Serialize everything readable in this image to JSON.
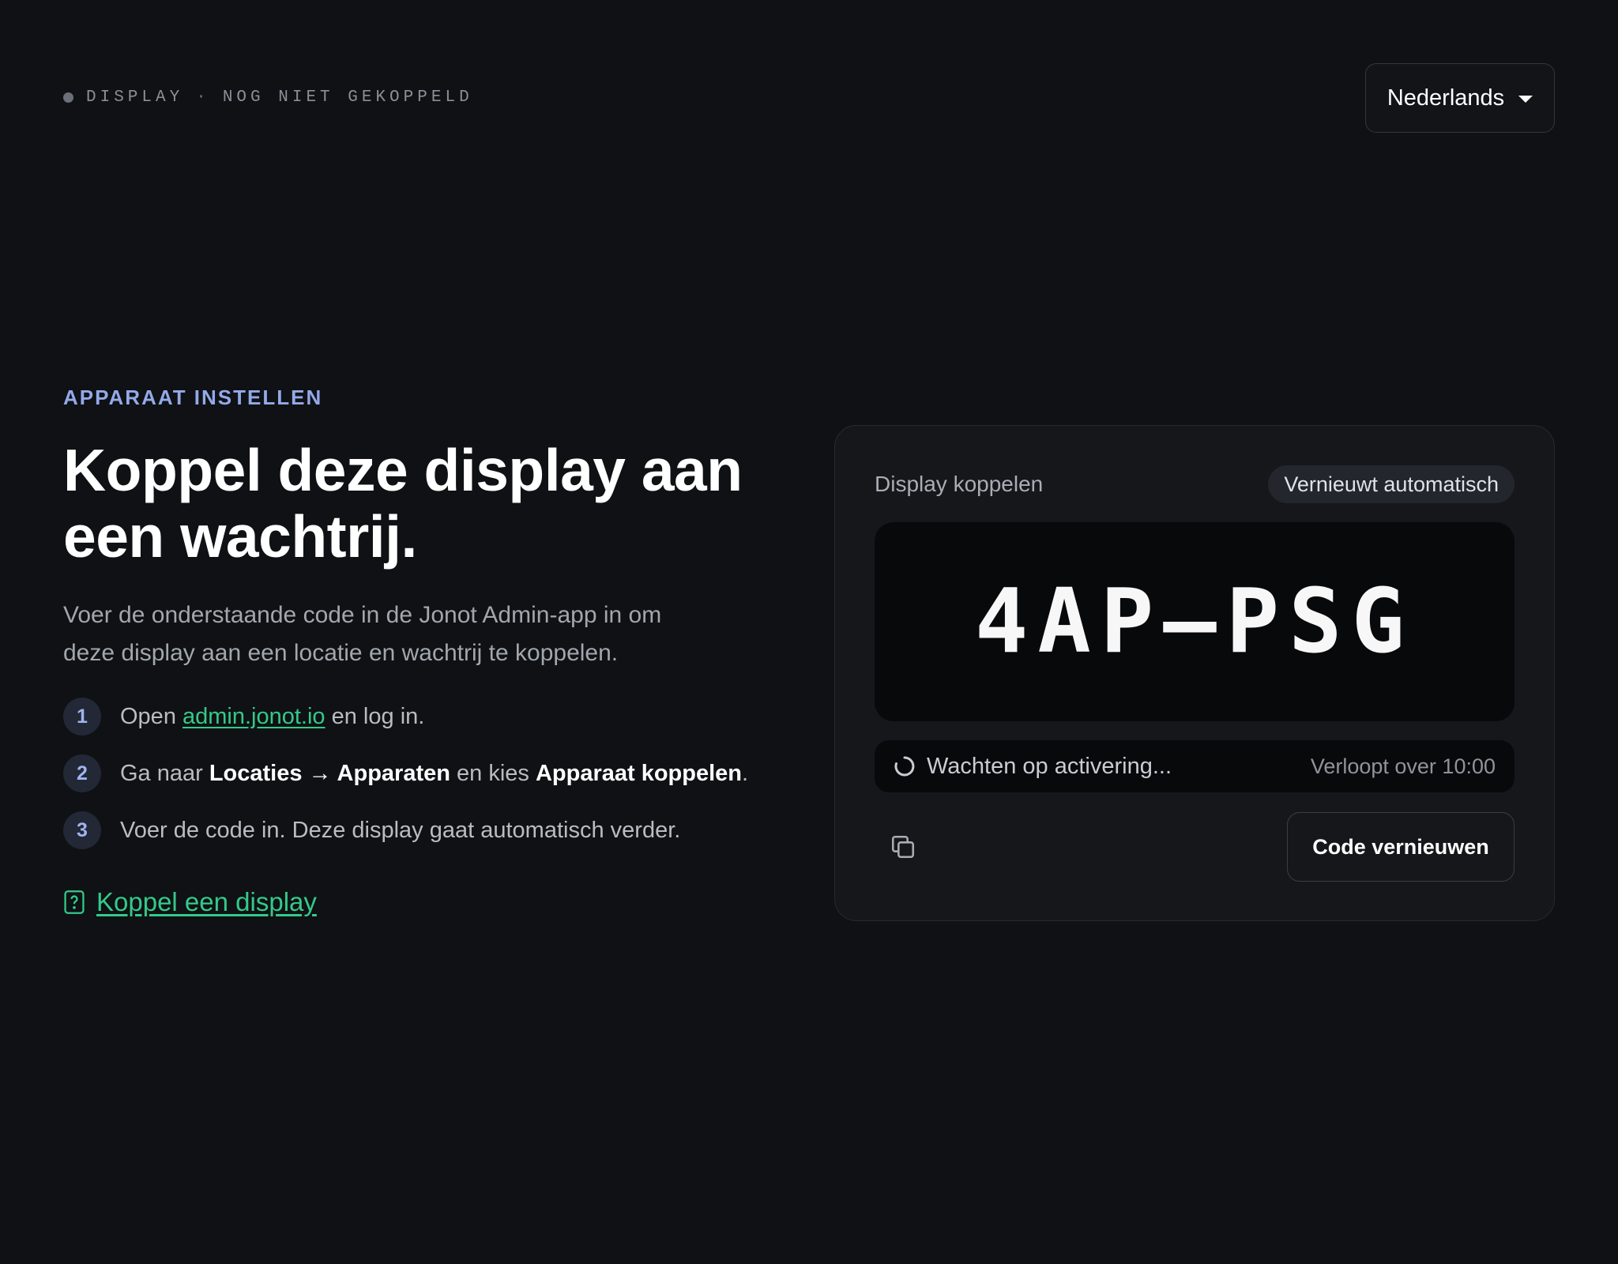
{
  "header": {
    "status_label": "DISPLAY",
    "status_separator": "·",
    "status_value": "NOG NIET GEKOPPELD",
    "language": "Nederlands"
  },
  "intro": {
    "eyebrow": "APPARAAT INSTELLEN",
    "title": "Koppel deze display aan een wachtrij.",
    "description": "Voer de onderstaande code in de Jonot Admin-app in om deze display aan een locatie en wachtrij te koppelen."
  },
  "steps": [
    {
      "num": "1",
      "pre": "Open ",
      "link": "admin.jonot.io",
      "post": " en log in."
    },
    {
      "num": "2",
      "pre": "Ga naar ",
      "bold1": "Locaties → Apparaten",
      "mid": " en kies ",
      "bold2": "Apparaat koppelen",
      "post": "."
    },
    {
      "num": "3",
      "text": "Voer de code in. Deze display gaat automatisch verder."
    }
  ],
  "help_link": "Koppel een display",
  "card": {
    "title": "Display koppelen",
    "badge": "Vernieuwt automatisch",
    "code": "4AP–PSG",
    "waiting": "Wachten op activering...",
    "expiry": "Verloopt over 10:00",
    "renew_button": "Code vernieuwen"
  },
  "colors": {
    "background": "#0f1114",
    "accent_blue": "#93a9e8",
    "accent_green": "#34c98a",
    "card": "#15171b"
  },
  "icons": {
    "copy": "copy-icon",
    "help": "help-document-icon",
    "spinner": "spinner-icon",
    "dropdown": "chevron-down-icon"
  }
}
